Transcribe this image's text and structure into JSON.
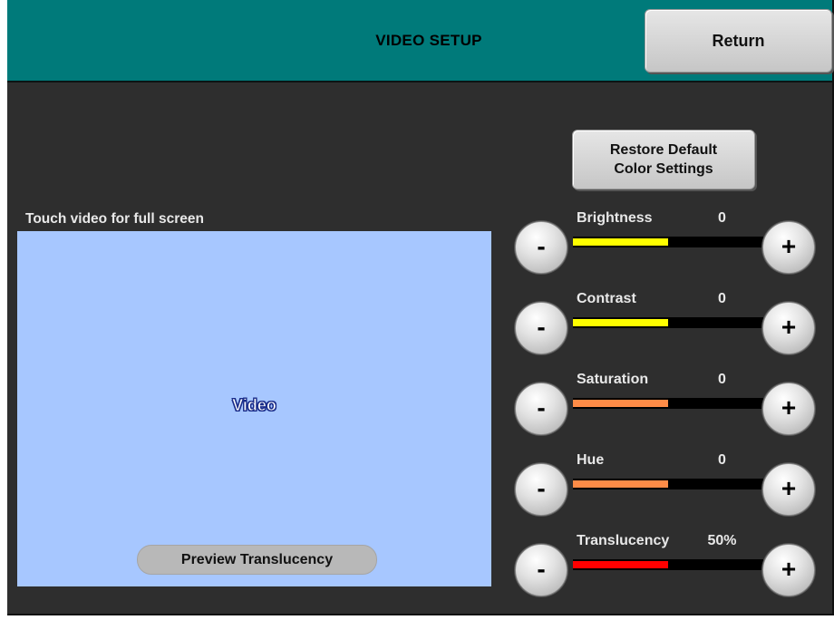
{
  "header": {
    "title": "VIDEO SETUP",
    "return_label": "Return"
  },
  "restore_button": {
    "line1": "Restore Default",
    "line2": "Color Settings"
  },
  "video": {
    "caption": "Touch video for full screen",
    "label": "Video",
    "preview_label": "Preview Translucency"
  },
  "controls": [
    {
      "label": "Brightness",
      "value": "0",
      "level": 0.5,
      "color": "#ffff00",
      "minus": "-",
      "plus": "+"
    },
    {
      "label": "Contrast",
      "value": "0",
      "level": 0.5,
      "color": "#ffff00",
      "minus": "-",
      "plus": "+"
    },
    {
      "label": "Saturation",
      "value": "0",
      "level": 0.5,
      "color": "#ff8c47",
      "minus": "-",
      "plus": "+"
    },
    {
      "label": "Hue",
      "value": "0",
      "level": 0.5,
      "color": "#ff8c47",
      "minus": "-",
      "plus": "+"
    },
    {
      "label": "Translucency",
      "value": "50%",
      "level": 0.5,
      "color": "#ff0000",
      "minus": "-",
      "plus": "+"
    }
  ],
  "colors": {
    "header_bg": "#007a7a",
    "screen_bg": "#2e2e2e",
    "video_bg": "#a7c7ff"
  }
}
